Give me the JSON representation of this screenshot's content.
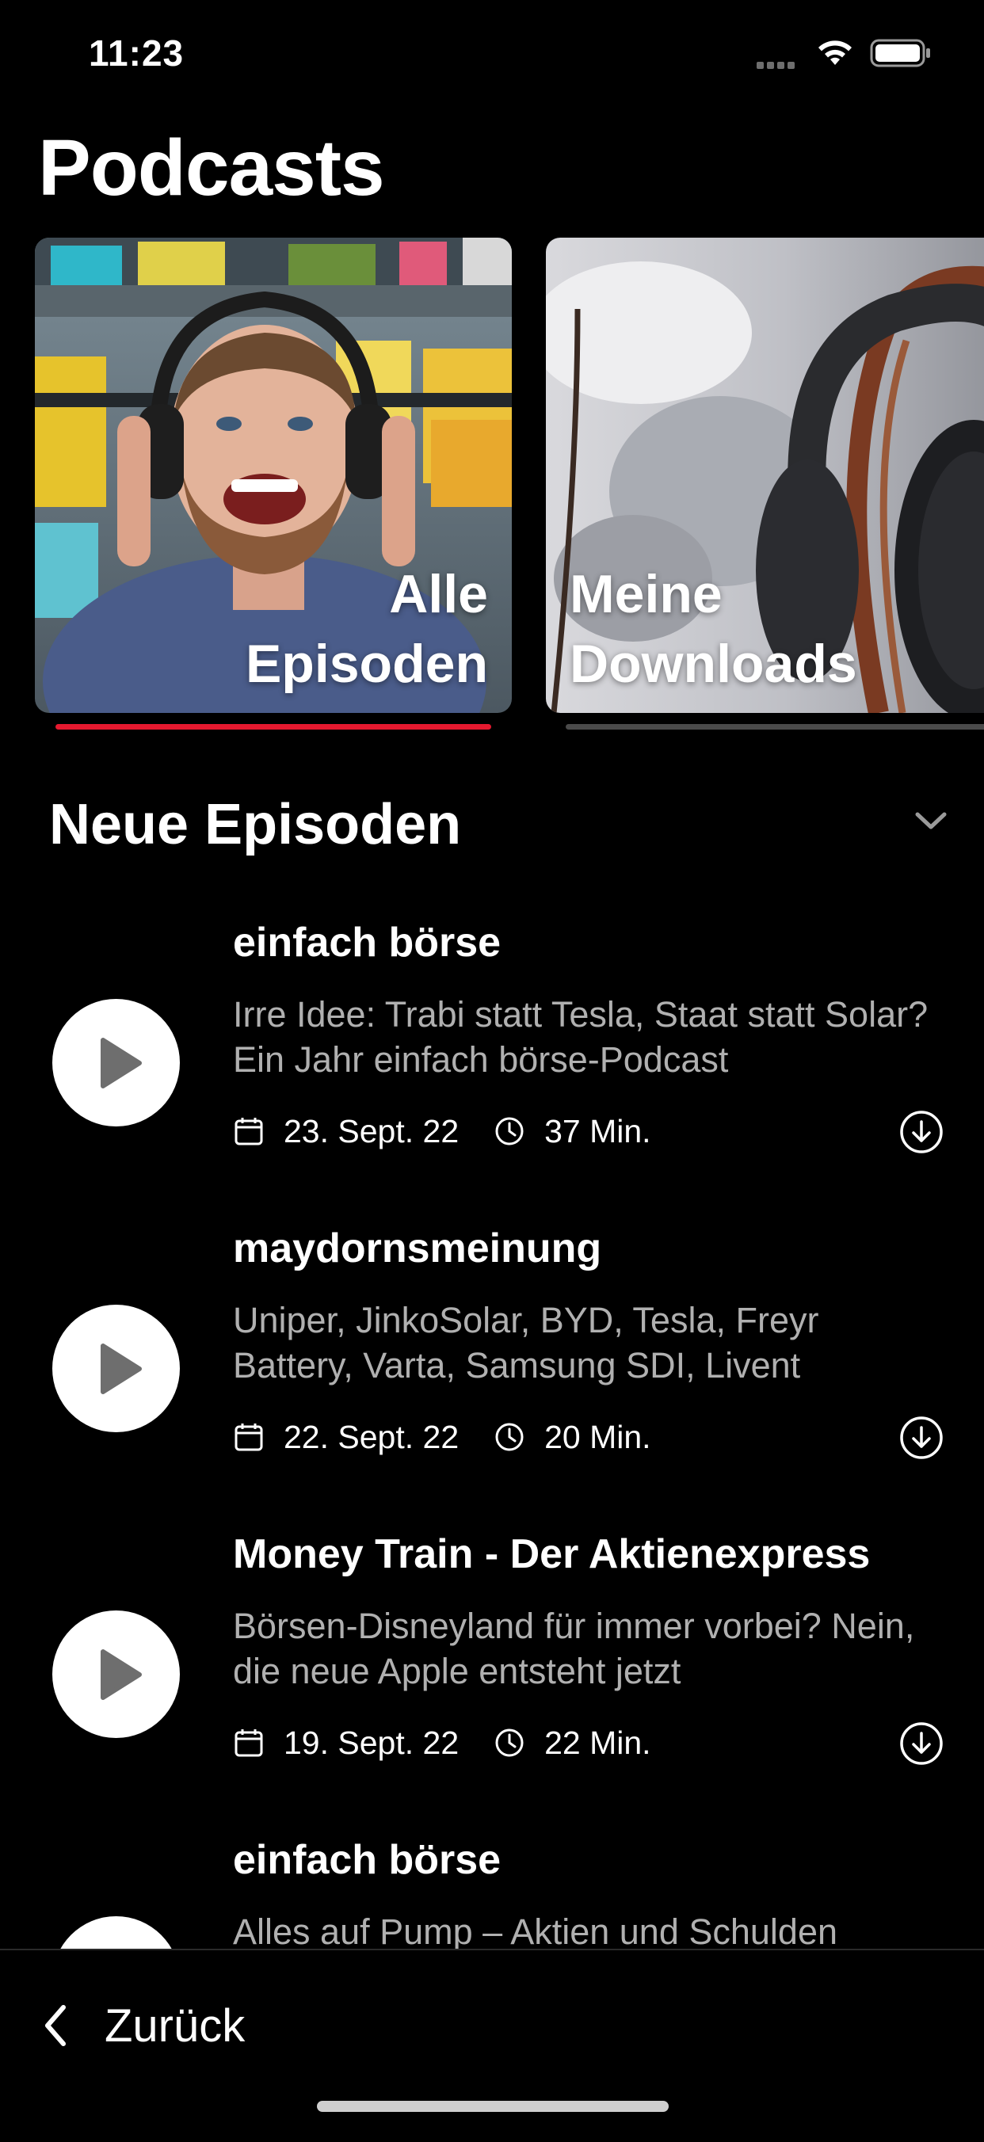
{
  "status_bar": {
    "time": "11:23"
  },
  "header": {
    "title": "Podcasts"
  },
  "cards": [
    {
      "label_line1": "Alle",
      "label_line2": "Episoden",
      "selected": true
    },
    {
      "label_line1": "Meine",
      "label_line2": "Downloads",
      "selected": false
    }
  ],
  "section": {
    "title": "Neue Episoden"
  },
  "episodes": [
    {
      "show": "einfach börse",
      "title": "Irre Idee: Trabi statt Tesla, Staat statt Solar? Ein Jahr einfach börse-Podcast",
      "date": "23. Sept. 22",
      "duration": "37 Min."
    },
    {
      "show": "maydornsmeinung",
      "title": "Uniper, JinkoSolar, BYD, Tesla, Freyr Battery, Varta, Samsung SDI, Livent",
      "date": "22. Sept. 22",
      "duration": "20 Min."
    },
    {
      "show": "Money Train - Der Aktienexpress",
      "title": "Börsen-Disneyland für immer vorbei? Nein, die neue Apple entsteht jetzt",
      "date": "19. Sept. 22",
      "duration": "22 Min."
    },
    {
      "show": "einfach börse",
      "title": "Alles auf Pump – Aktien und Schulden"
    }
  ],
  "footer": {
    "back_label": "Zurück"
  },
  "colors": {
    "accent": "#e5192f",
    "background": "#000000",
    "secondary_text": "#b0b0b0"
  },
  "icons": [
    "wifi-icon",
    "battery-icon",
    "chevron-down-icon",
    "play-icon",
    "calendar-icon",
    "clock-icon",
    "download-icon",
    "back-chevron-icon"
  ]
}
